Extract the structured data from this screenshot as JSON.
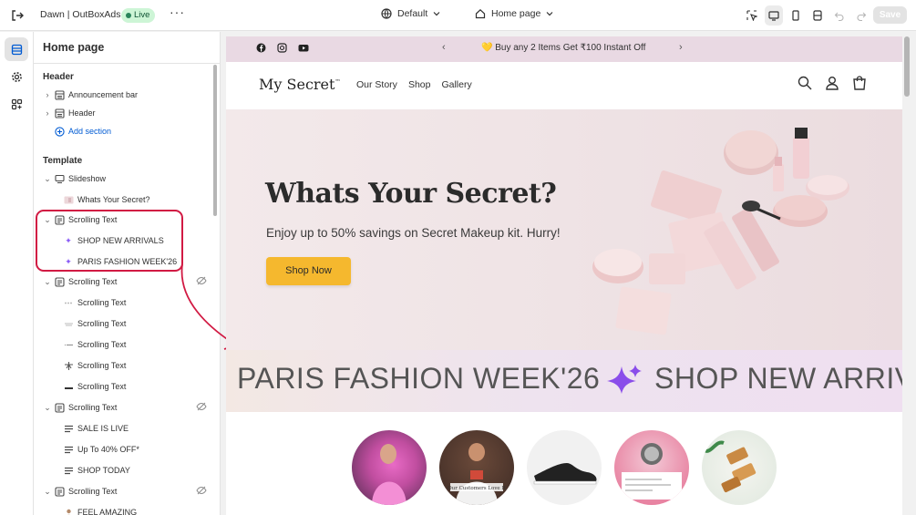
{
  "topbar": {
    "store_name": "Dawn | OutBoxAds",
    "status_badge": "Live",
    "more_label": "···",
    "theme_selector": "Default",
    "page_selector": "Home page",
    "save_label": "Save"
  },
  "sidebar": {
    "page_title": "Home page",
    "header_group": {
      "heading": "Header",
      "items": [
        "Announcement bar",
        "Header"
      ],
      "add_section": "Add section"
    },
    "template_group": {
      "heading": "Template",
      "slideshow": {
        "label": "Slideshow",
        "child": "Whats Your Secret?"
      },
      "scrolling_text_1": {
        "label": "Scrolling Text",
        "children": [
          "SHOP NEW ARRIVALS",
          "PARIS FASHION WEEK'26"
        ]
      },
      "scrolling_text_2": {
        "label": "Scrolling Text",
        "children": [
          "Scrolling Text",
          "Scrolling Text",
          "Scrolling Text",
          "Scrolling Text",
          "Scrolling Text"
        ]
      },
      "scrolling_text_3": {
        "label": "Scrolling Text",
        "children": [
          "SALE IS LIVE",
          "Up To 40% OFF*",
          "SHOP TODAY"
        ]
      },
      "scrolling_text_4": {
        "label": "Scrolling Text",
        "children": [
          "FEEL AMAZING"
        ]
      }
    }
  },
  "preview": {
    "announcement": "💛 Buy any 2 Items Get ₹100 Instant Off",
    "logo": "My Secret",
    "logo_tm": "™",
    "nav_links": [
      "Our Story",
      "Shop",
      "Gallery"
    ],
    "hero": {
      "heading": "Whats Your Secret?",
      "subheading": "Enjoy up to 50% savings on Secret Makeup kit. Hurry!",
      "button": "Shop Now"
    },
    "marquee": {
      "text_1": "PARIS FASHION WEEK'26",
      "text_2": "SHOP NEW ARRIVALS"
    },
    "collection_caption": "Our Customers Love It"
  },
  "colors": {
    "live_badge_bg": "#cdf5d6",
    "highlight_red": "#d11a43",
    "hero_button": "#f5b82e",
    "announcement_bg": "#e9d9e3",
    "link_blue": "#005bd3"
  }
}
